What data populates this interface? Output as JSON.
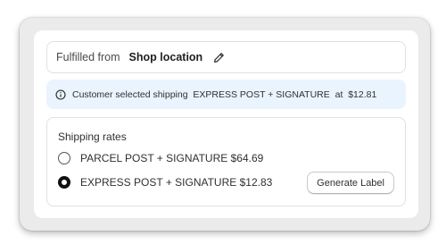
{
  "fulfillment": {
    "prefix": "Fulfilled from",
    "location": "Shop location",
    "edit_icon": "pencil-icon"
  },
  "banner": {
    "icon": "info-icon",
    "text": "Customer selected shipping  EXPRESS POST + SIGNATURE  at  $12.81"
  },
  "shipping_rates": {
    "heading": "Shipping rates",
    "options": [
      {
        "label": "PARCEL POST + SIGNATURE $64.69",
        "selected": false
      },
      {
        "label": "EXPRESS POST + SIGNATURE $12.83",
        "selected": true
      }
    ],
    "generate_label": "Generate Label"
  },
  "colors": {
    "banner_bg": "#eaf4ff",
    "border": "#e1e1e1",
    "frame_bg": "#ebebeb"
  }
}
